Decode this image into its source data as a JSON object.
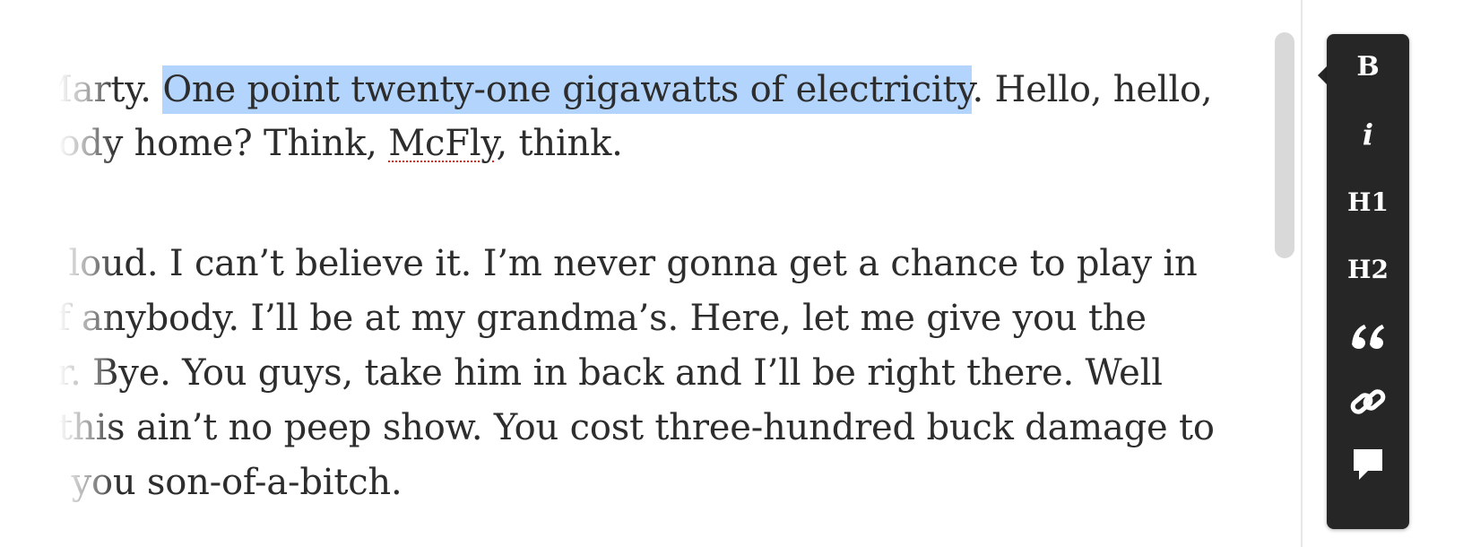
{
  "editor": {
    "lines": [
      {
        "before": "Marty. ",
        "selected": "One point twenty-one gigawatts of electricity",
        "after": ". Hello, hello,"
      },
      {
        "before": "body home? Think, ",
        "misspelled": "McFly",
        "after": ", think."
      },
      {
        "text": "o loud. I can’t believe it. I’m never gonna get a chance to play in"
      },
      {
        "text": "of anybody. I’ll be at my grandma’s. Here, let me give you the"
      },
      {
        "text": "er. Bye. You guys, take him in back and I’ll be right there. Well"
      },
      {
        "text": ", this ain’t no peep show. You cost three-hundred buck damage to"
      },
      {
        "text": "r, you son-of-a-bitch."
      }
    ],
    "selection_color": "#b3d4fc",
    "spellcheck_color": "#e0241b",
    "text_color": "#2d2d2d"
  },
  "toolbar": {
    "background": "#262626",
    "buttons": [
      {
        "label": "B",
        "icon": "bold-icon"
      },
      {
        "label": "i",
        "icon": "italic-icon"
      },
      {
        "label": "H1",
        "icon": "heading-1-icon"
      },
      {
        "label": "H2",
        "icon": "heading-2-icon"
      },
      {
        "label": "",
        "icon": "quote-icon"
      },
      {
        "label": "",
        "icon": "link-icon"
      },
      {
        "label": "",
        "icon": "comment-icon"
      }
    ]
  }
}
